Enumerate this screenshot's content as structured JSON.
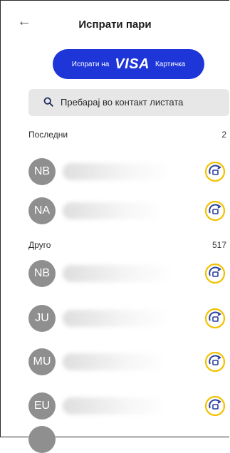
{
  "header": {
    "back_icon": "arrow-left-icon",
    "title": "Испрати пари"
  },
  "visa_button": {
    "prefix": "Испрати на",
    "brand": "VISA",
    "suffix": "Картичка",
    "color": "#1e35d8"
  },
  "search": {
    "icon": "search-icon",
    "placeholder": "Пребарај во контакт листата"
  },
  "recent": {
    "label": "Последни",
    "count": "2",
    "contacts": [
      {
        "initials": "NB"
      },
      {
        "initials": "NA"
      }
    ]
  },
  "other": {
    "label": "Друго",
    "count": "517",
    "contacts": [
      {
        "initials": "NB"
      },
      {
        "initials": "JU"
      },
      {
        "initials": "MU"
      },
      {
        "initials": "EU"
      }
    ]
  },
  "send_icon": "send-money-icon"
}
